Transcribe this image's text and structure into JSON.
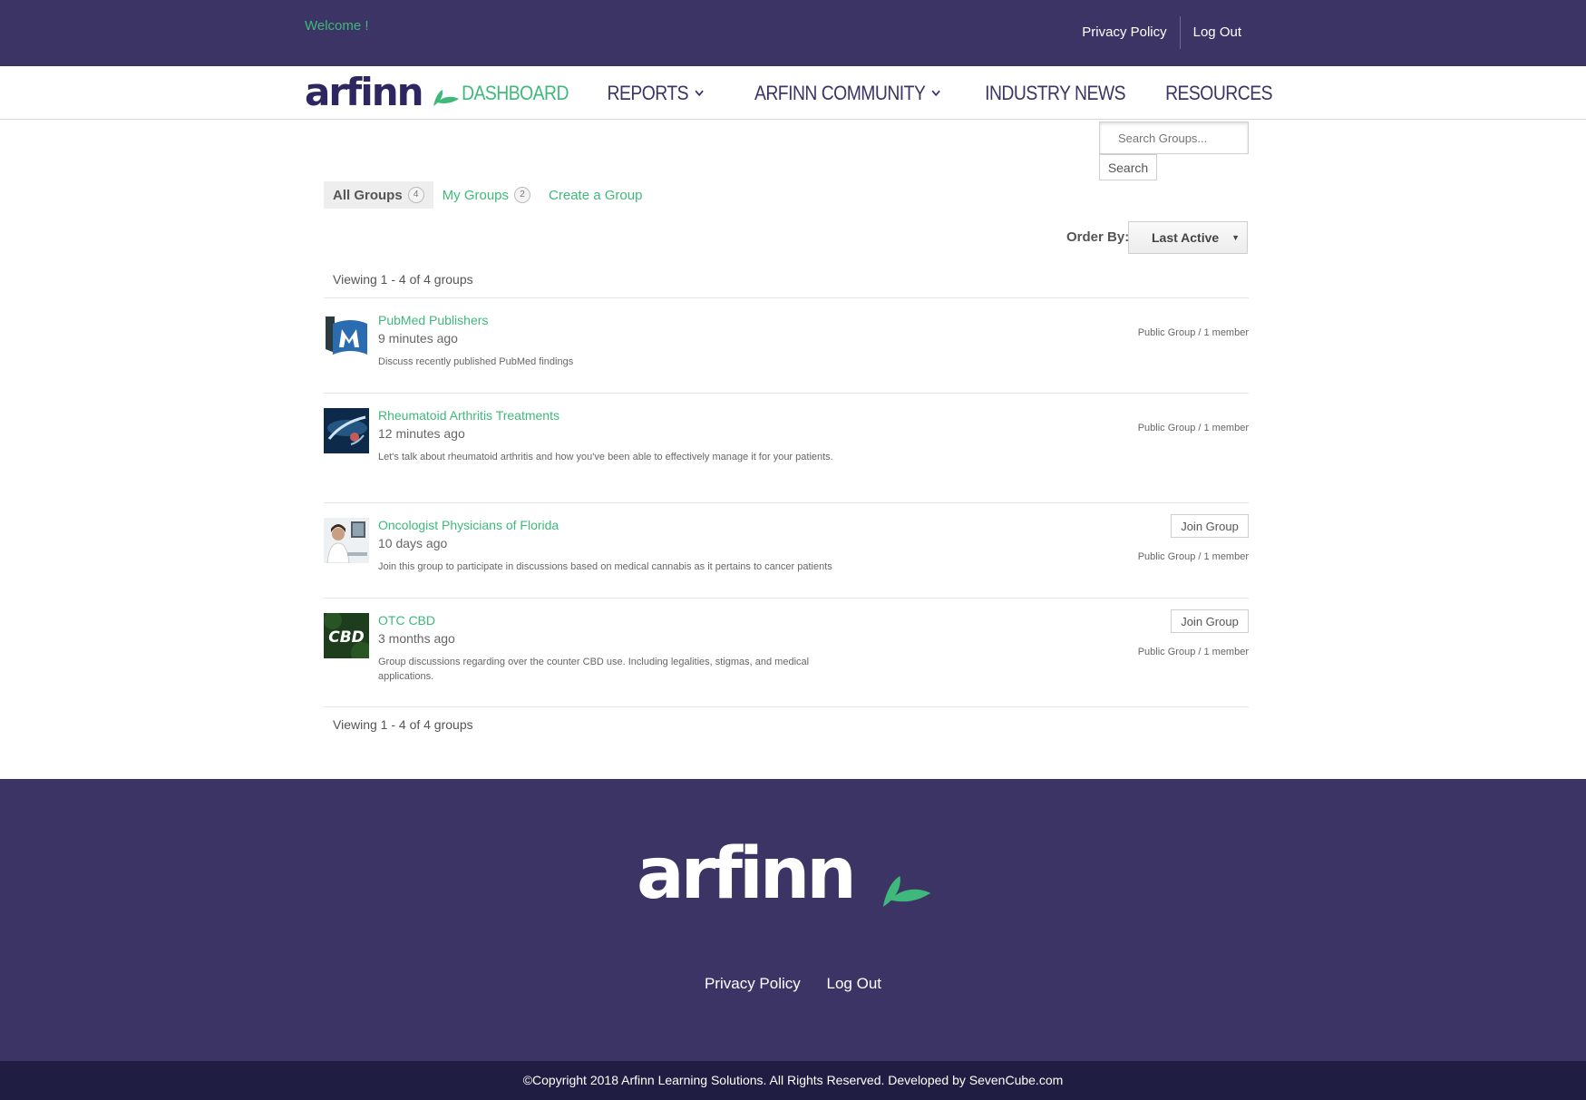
{
  "topbar": {
    "welcome": "Welcome !",
    "links": [
      "Privacy Policy",
      "Log Out"
    ]
  },
  "brand": {
    "logo_text": "arfinn"
  },
  "nav": {
    "items": [
      {
        "label": "DASHBOARD",
        "active": true
      },
      {
        "label": "REPORTS",
        "dropdown": true
      },
      {
        "label": "ARFINN COMMUNITY",
        "dropdown": true
      },
      {
        "label": "INDUSTRY NEWS"
      },
      {
        "label": "RESOURCES"
      }
    ]
  },
  "search": {
    "placeholder": "Search Groups...",
    "button": "Search"
  },
  "tabs": [
    {
      "label": "All Groups",
      "count": "4",
      "active": true
    },
    {
      "label": "My Groups",
      "count": "2"
    },
    {
      "label": "Create a Group"
    }
  ],
  "order": {
    "label": "Order By:",
    "selected": "Last Active"
  },
  "viewing": "Viewing 1 - 4 of 4 groups",
  "groups": [
    {
      "name": "PubMed Publishers",
      "time": "9 minutes ago",
      "description": "Discuss recently published PubMed findings",
      "meta": "Public Group / 1 member",
      "join": ""
    },
    {
      "name": "Rheumatoid Arthritis Treatments",
      "time": "12 minutes ago",
      "description": "Let's talk about rheumatoid arthritis and how you've been able to effectively manage it for your patients.",
      "meta": "Public Group / 1 member",
      "join": ""
    },
    {
      "name": "Oncologist Physicians of Florida",
      "time": "10 days ago",
      "description": "Join this group to participate in discussions based on medical cannabis as it pertains to cancer patients",
      "meta": "Public Group / 1 member",
      "join": "Join Group"
    },
    {
      "name": "OTC CBD",
      "time": "3 months ago",
      "description": "Group discussions regarding over the counter CBD use. Including legalities, stigmas, and medical applications.",
      "meta": "Public Group / 1 member",
      "join": "Join Group",
      "avatar_text": "CBD"
    }
  ],
  "footer": {
    "logo_text": "arfinn",
    "links": [
      "Privacy Policy",
      "Log Out"
    ],
    "copyright": "©Copyright 2018 Arfinn Learning Solutions. All Rights Reserved. Developed by SevenCube.com"
  },
  "colors": {
    "primary": "#3b3464",
    "accent": "#3fb97b",
    "dark": "#1f1d42"
  },
  "icons": [
    "leaf-icon",
    "chevron-down-icon",
    "select-arrow-icon"
  ]
}
